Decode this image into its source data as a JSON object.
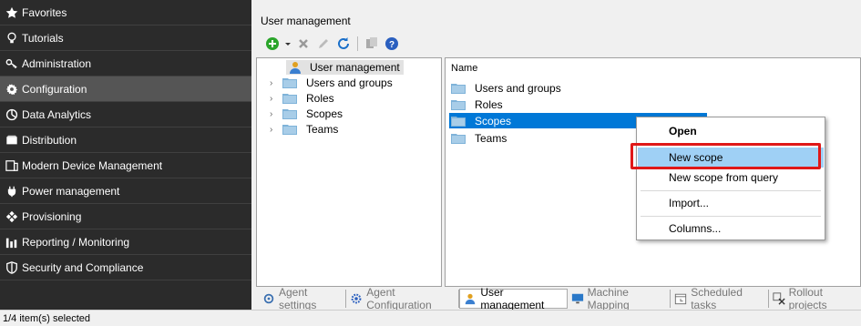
{
  "sidebar": {
    "items": [
      {
        "label": "Favorites",
        "icon": "star-icon"
      },
      {
        "label": "Tutorials",
        "icon": "lightbulb-icon"
      },
      {
        "label": "Administration",
        "icon": "key-icon"
      },
      {
        "label": "Configuration",
        "icon": "gear-icon",
        "active": true
      },
      {
        "label": "Data Analytics",
        "icon": "analytics-icon"
      },
      {
        "label": "Distribution",
        "icon": "box-icon"
      },
      {
        "label": "Modern Device Management",
        "icon": "device-icon"
      },
      {
        "label": "Power management",
        "icon": "plug-icon"
      },
      {
        "label": "Provisioning",
        "icon": "provisioning-icon"
      },
      {
        "label": "Reporting / Monitoring",
        "icon": "bar-chart-icon"
      },
      {
        "label": "Security and Compliance",
        "icon": "shield-icon"
      }
    ]
  },
  "main": {
    "title": "User management",
    "tree": {
      "root": "User management",
      "nodes": [
        "Users and groups",
        "Roles",
        "Scopes",
        "Teams"
      ]
    },
    "list": {
      "header": "Name",
      "rows": [
        "Users and groups",
        "Roles",
        "Scopes",
        "Teams"
      ],
      "selected_index": 2
    },
    "context_menu": {
      "items": [
        "Open",
        "New scope",
        "New scope from query",
        "Import...",
        "Columns..."
      ]
    }
  },
  "tabs": [
    {
      "label": "Agent settings",
      "icon": "agent-settings-icon"
    },
    {
      "label": "Agent Configuration",
      "icon": "gear-icon"
    },
    {
      "label": "User management",
      "icon": "user-icon",
      "active": true
    },
    {
      "label": "Machine Mapping",
      "icon": "monitor-icon"
    },
    {
      "label": "Scheduled tasks",
      "icon": "calendar-icon"
    },
    {
      "label": "Rollout projects",
      "icon": "rollout-icon"
    }
  ],
  "status": {
    "text": "1/4 item(s) selected"
  },
  "colors": {
    "sidebar_bg": "#2b2b2b",
    "selection": "#0078d7",
    "menu_highlight": "#9fd0f5",
    "callout_border": "#e01818"
  }
}
